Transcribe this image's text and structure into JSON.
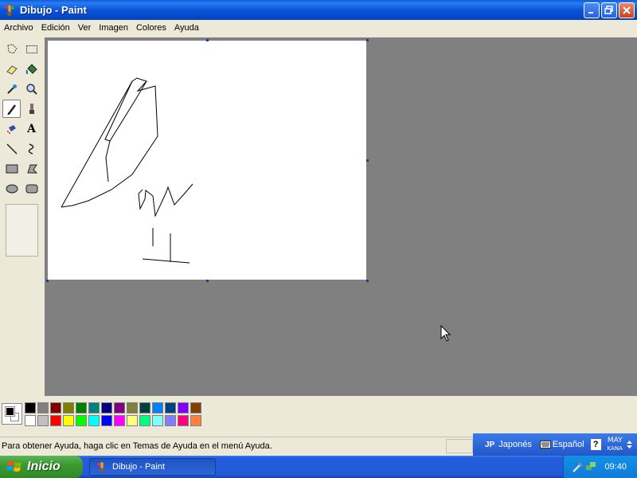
{
  "window": {
    "title": "Dibujo - Paint",
    "minimize_icon": "minimize-icon",
    "maximize_icon": "restore-icon",
    "close_icon": "close-icon"
  },
  "menu": {
    "items": [
      {
        "label": "Archivo"
      },
      {
        "label": "Edición"
      },
      {
        "label": "Ver"
      },
      {
        "label": "Imagen"
      },
      {
        "label": "Colores"
      },
      {
        "label": "Ayuda"
      }
    ]
  },
  "toolbox": {
    "tools": [
      {
        "icon": "free-form-select-icon"
      },
      {
        "icon": "rectangle-select-icon"
      },
      {
        "icon": "eraser-icon"
      },
      {
        "icon": "fill-bucket-icon"
      },
      {
        "icon": "color-picker-icon"
      },
      {
        "icon": "magnifier-icon"
      },
      {
        "icon": "pencil-icon",
        "active": true
      },
      {
        "icon": "brush-icon"
      },
      {
        "icon": "airbrush-icon"
      },
      {
        "icon": "text-icon",
        "glyph": "A"
      },
      {
        "icon": "line-icon"
      },
      {
        "icon": "curve-icon"
      },
      {
        "icon": "rectangle-icon"
      },
      {
        "icon": "polygon-icon"
      },
      {
        "icon": "ellipse-icon"
      },
      {
        "icon": "rounded-rectangle-icon"
      }
    ]
  },
  "palette": {
    "foreground": "#000000",
    "background": "#FFFFFF",
    "row1": [
      "#000000",
      "#808080",
      "#800000",
      "#808000",
      "#008000",
      "#008080",
      "#000080",
      "#800080",
      "#808040",
      "#004040",
      "#0080FF",
      "#004080",
      "#8000FF",
      "#804000"
    ],
    "row2": [
      "#FFFFFF",
      "#C0C0C0",
      "#FF0000",
      "#FFFF00",
      "#00FF00",
      "#00FFFF",
      "#0000FF",
      "#FF00FF",
      "#FFFF80",
      "#00FF80",
      "#80FFFF",
      "#8080FF",
      "#FF0080",
      "#FF8040"
    ]
  },
  "status": {
    "help_text": "Para obtener Ayuda, haga clic en Temas de Ayuda en el menú Ayuda."
  },
  "langbar": {
    "jp_code": "JP",
    "jp_label": "Japonés",
    "es_label": "Español",
    "help_glyph": "?",
    "caps_label": "MAY",
    "kana_label": "KANA"
  },
  "taskbar": {
    "start_label": "Inicio",
    "task_label": "Dibujo - Paint",
    "clock": "09:40"
  }
}
